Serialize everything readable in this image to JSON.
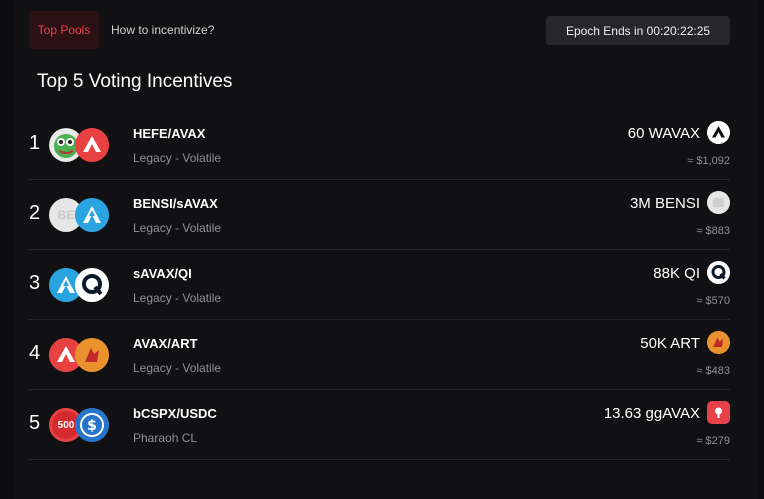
{
  "tabs": {
    "top_pools": "Top Pools",
    "incentivize": "How to incentivize?"
  },
  "epoch": {
    "label": "Epoch Ends in 00:20:22:25"
  },
  "title": "Top 5 Voting Incentives",
  "colors": {
    "accent_red": "#e8414a",
    "background": "#111113",
    "muted_text": "#8f8f94"
  },
  "rows": [
    {
      "rank": "1",
      "pair": "HEFE/AVAX",
      "type": "Legacy - Volatile",
      "amount": "60 WAVAX",
      "usd": "≈ $1,092",
      "icons": [
        "pepe-frog-icon",
        "avax-icon"
      ],
      "token_icon": "avax-icon"
    },
    {
      "rank": "2",
      "pair": "BENSI/sAVAX",
      "type": "Legacy - Volatile",
      "amount": "3M BENSI",
      "usd": "≈ $883",
      "icons": [
        "bensi-icon",
        "savax-icon"
      ],
      "token_icon": "bensi-icon"
    },
    {
      "rank": "3",
      "pair": "sAVAX/QI",
      "type": "Legacy - Volatile",
      "amount": "88K QI",
      "usd": "≈ $570",
      "icons": [
        "savax-icon",
        "qi-icon"
      ],
      "token_icon": "qi-icon"
    },
    {
      "rank": "4",
      "pair": "AVAX/ART",
      "type": "Legacy - Volatile",
      "amount": "50K ART",
      "usd": "≈ $483",
      "icons": [
        "avax-icon",
        "art-icon"
      ],
      "token_icon": "art-icon"
    },
    {
      "rank": "5",
      "pair": "bCSPX/USDC",
      "type": "Pharaoh CL",
      "amount": "13.63 ggAVAX",
      "usd": "≈ $279",
      "icons": [
        "bcspx-500-icon",
        "usdc-icon"
      ],
      "token_icon": "ggavax-icon"
    }
  ],
  "icon_text": {
    "bensi": "BE",
    "sp500": "500"
  }
}
